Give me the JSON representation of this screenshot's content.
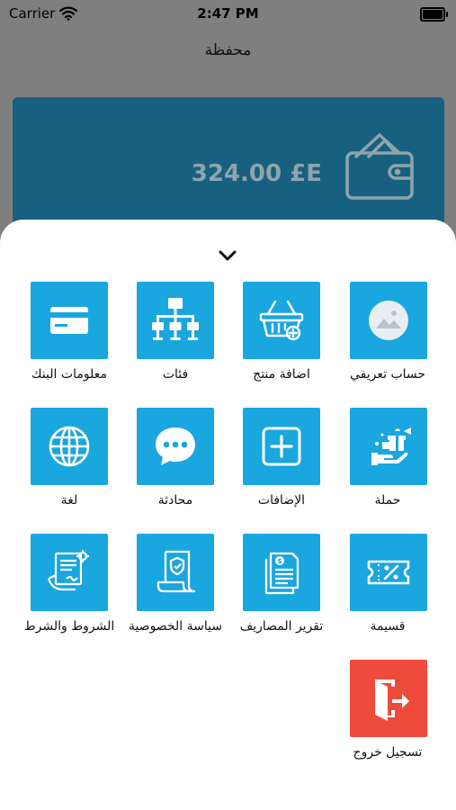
{
  "status_bar": {
    "carrier": "Carrier",
    "time": "2:47 PM"
  },
  "nav": {
    "title": "محفظة"
  },
  "wallet": {
    "balance": "324.00 £E"
  },
  "menu": {
    "profile": "حساب تعريفي",
    "add_product": "اضافة منتج",
    "categories": "فئات",
    "bank_info": "معلومات البنك",
    "campaign": "حملة",
    "addons": "الإضافات",
    "chat": "محادثة",
    "language": "لغة",
    "coupon": "قسيمة",
    "expense_report": "تقرير المصاريف",
    "privacy_policy": "سياسة الخصوصية",
    "terms": "الشروط والشرط",
    "logout": "تسجيل خروج"
  },
  "colors": {
    "tile": "#1aa6de",
    "logout_tile": "#ef4b3c",
    "card": "#17607f"
  }
}
